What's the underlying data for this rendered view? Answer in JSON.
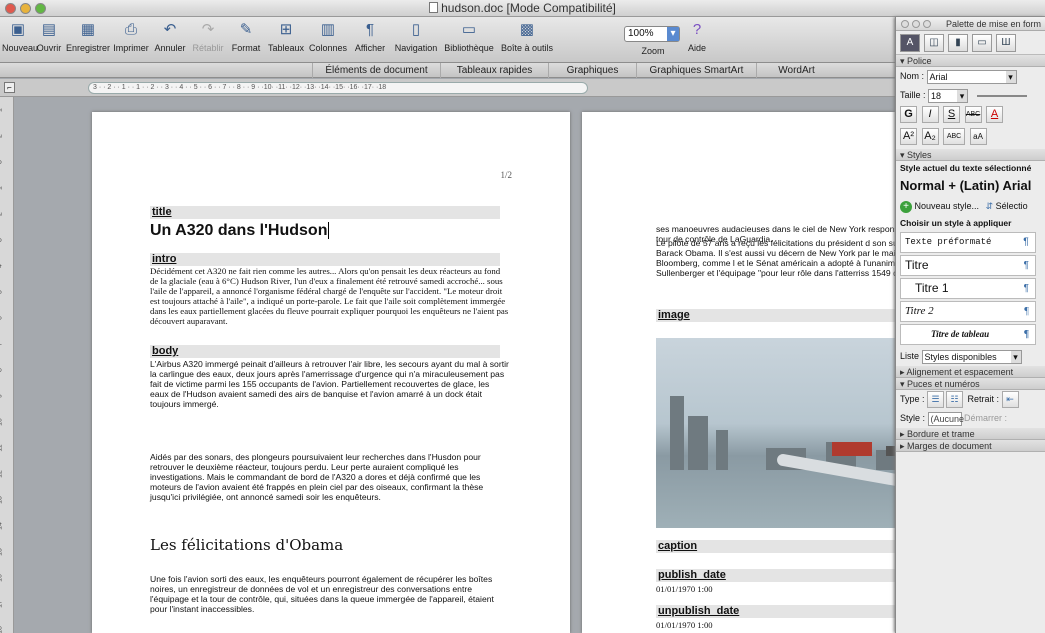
{
  "window": {
    "title": "hudson.doc [Mode Compatibilité]"
  },
  "toolbar": {
    "buttons": [
      {
        "label": "Nouveau",
        "icon": "new-document-icon"
      },
      {
        "label": "Ouvrir",
        "icon": "open-folder-icon"
      },
      {
        "label": "Enregistrer",
        "icon": "save-icon"
      },
      {
        "label": "Imprimer",
        "icon": "print-icon"
      },
      {
        "label": "Annuler",
        "icon": "undo-icon"
      },
      {
        "label": "Rétablir",
        "icon": "redo-icon",
        "disabled": true
      },
      {
        "label": "Format",
        "icon": "format-brush-icon"
      },
      {
        "label": "Tableaux",
        "icon": "table-icon"
      },
      {
        "label": "Colonnes",
        "icon": "columns-icon"
      },
      {
        "label": "Afficher",
        "icon": "pilcrow-icon"
      },
      {
        "label": "Navigation",
        "icon": "navigation-icon"
      },
      {
        "label": "Bibliothèque",
        "icon": "library-icon"
      },
      {
        "label": "Boîte à outils",
        "icon": "toolbox-icon"
      },
      {
        "label": "Zoom",
        "icon": "zoom-icon"
      },
      {
        "label": "Aide",
        "icon": "help-icon"
      }
    ],
    "zoom_value": "100%"
  },
  "ribbon": {
    "tabs": [
      "Éléments de document",
      "Tableaux rapides",
      "Graphiques",
      "Graphiques SmartArt",
      "WordArt"
    ]
  },
  "ruler": {
    "text": "3 · · 2 · · 1 · · 1 · · 2 · · 3 · · 4 · · 5 · · 6 · · 7 · · 8 · · 9 · ·10· ·11· ·12· ·13· ·14· ·15· ·16· ·17· ·18"
  },
  "vruler": {
    "marks": [
      "1",
      "2",
      "3",
      "1",
      "2",
      "3",
      "4",
      "5",
      "6",
      "7",
      "8",
      "9",
      "10",
      "11",
      "12",
      "13",
      "14",
      "15",
      "16",
      "17",
      "18",
      "19"
    ]
  },
  "page1": {
    "page_number": "1/2",
    "title_label": "title",
    "title_text": "Un A320 dans l'Hudson",
    "intro_label": "intro",
    "intro_text": "Décidément cet A320 ne fait rien comme les autres... Alors qu'on pensait les deux réacteurs au fond de la glaciale (eau à 6°C) Hudson River, l'un d'eux a finalement été retrouvé samedi accroché... sous l'aile de l'appareil, a annoncé l'organisme fédéral chargé de l'enquête sur l'accident. \"Le moteur droit est toujours attaché à l'aile\", a indiqué un porte-parole. Le fait que l'aile soit complètement immergée dans les eaux partiellement glacées du fleuve pourrait expliquer pourquoi les enquêteurs ne l'aient pas découvert auparavant.",
    "body_label": "body",
    "body_text_1": "L'Airbus A320 immergé peinait d'ailleurs à retrouver l'air libre, les secours ayant du mal à sortir la carlingue des eaux, deux jours après l'amerrissage d'urgence qui n'a miraculeusement pas fait de victime parmi les 155 occupants de l'avion. Partiellement recouvertes de glace, les eaux de l'Hudson avaient samedi des airs de banquise et l'avion amarré à un dock était toujours immergé.",
    "body_text_2": "Aidés par des sonars, des plongeurs poursuivaient leur recherches dans l'Husdon pour retrouver le deuxième réacteur, toujours perdu. Leur perte auraient compliqué les investigations. Mais le commandant de bord de l'A320 a dores et déjà confirmé que les moteurs de l'avion avaient été frappés en plein ciel par des oiseaux, confirmant la thèse jusqu'ici privilégiée, ont annoncé samedi soir les enquêteurs.",
    "heading2": "Les félicitations d'Obama",
    "body_text_3": "Une fois l'avion sorti des eaux, les enquêteurs pourront également de récupérer les boîtes noires, un enregistreur de données de vol et un enregistreur des conversations entre l'équipage et la tour de contrôle, qui, situées dans la queue immergée de l'appareil, étaient pour l'instant inaccessibles."
  },
  "page2": {
    "text_1": "ses manoeuvres audacieuses dans le ciel de New York responsables de la tour de contrôle de LaGuardia.",
    "text_2": "Le pilote de 57 ans a reçu les félicitations du président d son successeur Barack Obama. Il s'est aussi vu décern de New York par le maire Michael Bloomberg, comme l et le Sénat américain a adopté à l'unanimité une résolut Sullenberger et l'équipage \"pour leur rôle dans l'atterriss 1549 d'US Airways\".",
    "image_label": "image",
    "caption_label": "caption",
    "publish_label": "publish_date",
    "publish_value": "01/01/1970 1:00",
    "unpublish_label": "unpublish_date",
    "unpublish_value": "01/01/1970 1:00"
  },
  "palette": {
    "title": "Palette de mise en form",
    "police_section": "Police",
    "nom_label": "Nom :",
    "nom_value": "Arial",
    "taille_label": "Taille :",
    "taille_value": "18",
    "styles_section": "Styles",
    "current_style_label": "Style actuel du texte sélectionné",
    "current_style_value": "Normal + (Latin) Arial",
    "new_style": "Nouveau style...",
    "select": "Sélectio",
    "choose_label": "Choisir un style à appliquer",
    "style_items": [
      "Texte préformaté",
      "Titre",
      "Titre 1",
      "Titre 2",
      "Titre de tableau"
    ],
    "liste_label": "Liste",
    "liste_value": "Styles disponibles",
    "align_section": "Alignement et espacement",
    "puces_section": "Puces et numéros",
    "type_label": "Type :",
    "retrait_label": "Retrait :",
    "style_label": "Style :",
    "style_value": "(Aucune",
    "demarrer_label": "Démarrer :",
    "bordure_section": "Bordure et trame",
    "marges_section": "Marges de document"
  }
}
